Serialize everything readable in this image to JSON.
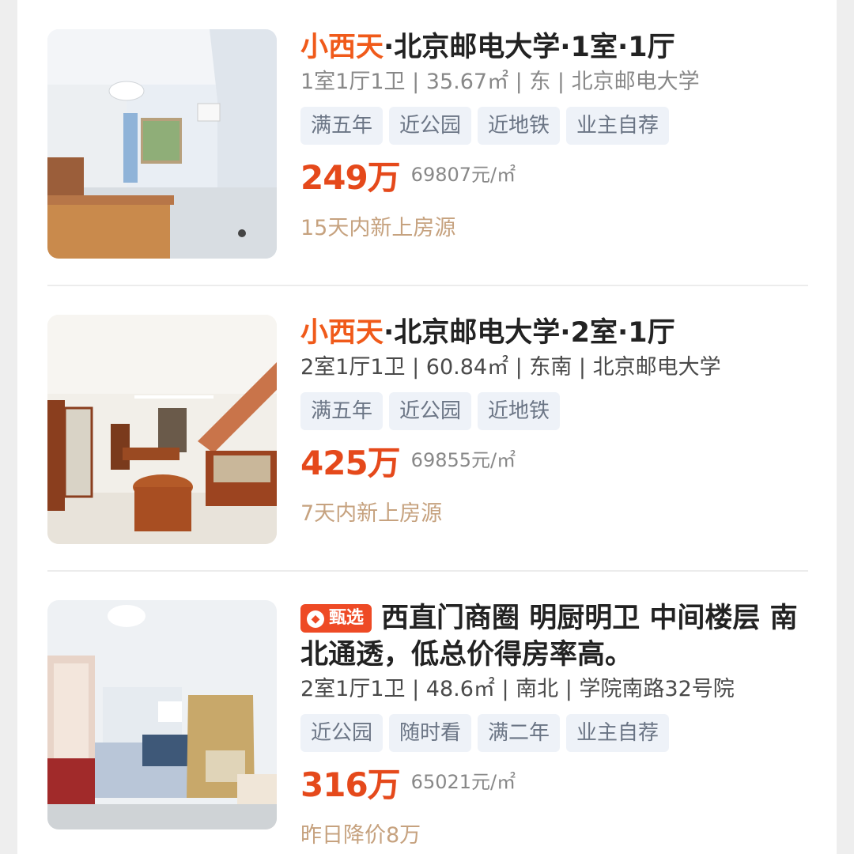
{
  "listings": [
    {
      "title_highlight": "小西天",
      "title_rest": "·北京邮电大学·1室·1厅",
      "meta": "1室1厅1卫 | 35.67㎡ | 东 | 北京邮电大学",
      "tags": [
        "满五年",
        "近公园",
        "近地铁",
        "业主自荐"
      ],
      "price": "249万",
      "unit_price": "69807元/㎡",
      "note": "15天内新上房源",
      "image_icon": "bedroom-photo"
    },
    {
      "title_highlight": "小西天",
      "title_rest": "·北京邮电大学·2室·1厅",
      "meta": "2室1厅1卫 | 60.84㎡ | 东南 | 北京邮电大学",
      "tags": [
        "满五年",
        "近公园",
        "近地铁"
      ],
      "price": "425万",
      "unit_price": "69855元/㎡",
      "note": "7天内新上房源",
      "image_icon": "living-room-photo"
    },
    {
      "badge": "甄选",
      "badge_icon": "heart-diamond-icon",
      "title_full": "西直门商圈 明厨明卫 中间楼层 南北通透，低总价得房率高。",
      "meta": "2室1厅1卫 | 48.6㎡ | 南北 | 学院南路32号院",
      "tags": [
        "近公园",
        "随时看",
        "满二年",
        "业主自荐"
      ],
      "price": "316万",
      "unit_price": "65021元/㎡",
      "note": "昨日降价8万",
      "image_icon": "cluttered-bedroom-photo"
    }
  ],
  "colors": {
    "accent": "#f05a1a",
    "price": "#e5491b",
    "tag_bg": "#eef2f8",
    "note": "#c6a27f",
    "badge": "#ee4a25"
  }
}
